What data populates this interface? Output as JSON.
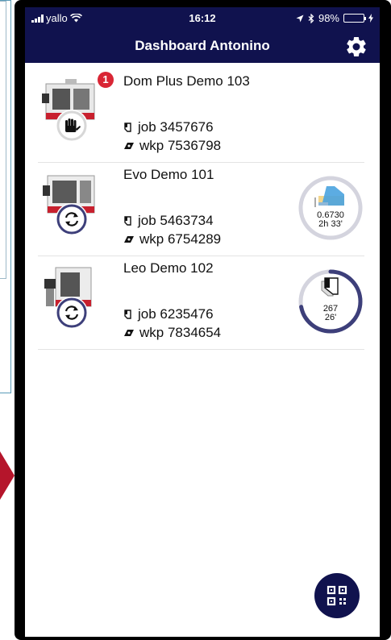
{
  "status_bar": {
    "carrier": "yallo",
    "time": "16:12",
    "battery": "98%",
    "battery_level": 0.98
  },
  "header": {
    "title": "Dashboard Antonino",
    "settings_icon": "gear-icon"
  },
  "machines": [
    {
      "name": "Dom Plus Demo 103",
      "alert_count": "1",
      "job": "job 3457676",
      "wkp": "wkp 7536798",
      "mode_icon": "hand-stop-icon",
      "gauge": null
    },
    {
      "name": "Evo Demo 101",
      "job": "job 5463734",
      "wkp": "wkp 6754289",
      "mode_icon": "cycle-icon",
      "gauge": {
        "line1": "0.6730",
        "line2": "2h 33'",
        "progress": 0
      }
    },
    {
      "name": "Leo Demo 102",
      "job": "job 6235476",
      "wkp": "wkp 7834654",
      "mode_icon": "cycle-icon",
      "gauge": {
        "line1": "267",
        "line2": "26'",
        "progress": 0.72
      }
    }
  ],
  "fab": {
    "icon": "qr-code-icon"
  },
  "colors": {
    "header": "#10124e",
    "accent_ring": "#3d3f7a",
    "alert": "#d92635",
    "machine_red": "#c8202e"
  }
}
